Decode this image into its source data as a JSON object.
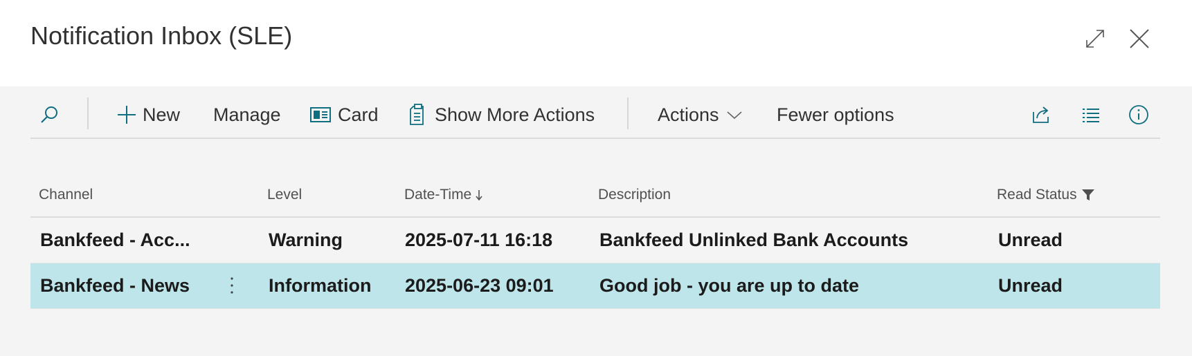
{
  "window": {
    "title": "Notification Inbox (SLE)",
    "expand_icon": "expand-icon",
    "close_icon": "close-icon"
  },
  "toolbar": {
    "search_icon": "search-icon",
    "new_label": "New",
    "manage_label": "Manage",
    "card_label": "Card",
    "show_more_actions_label": "Show More Actions",
    "actions_label": "Actions",
    "fewer_options_label": "Fewer options",
    "share_icon": "share-icon",
    "list_icon": "list-view-icon",
    "info_icon": "info-icon"
  },
  "table": {
    "columns": {
      "channel": "Channel",
      "level": "Level",
      "datetime": "Date-Time",
      "description": "Description",
      "read_status": "Read Status"
    },
    "sort_column": "datetime",
    "sort_direction": "descending",
    "filtered_column": "read_status",
    "rows": [
      {
        "channel": "Bankfeed - Acc...",
        "level": "Warning",
        "datetime": "2025-07-11 16:18",
        "description": "Bankfeed Unlinked Bank Accounts",
        "read_status": "Unread",
        "selected": false
      },
      {
        "channel": "Bankfeed - News",
        "level": "Information",
        "datetime": "2025-06-23 09:01",
        "description": "Good job - you are up to date",
        "read_status": "Unread",
        "selected": true
      }
    ]
  },
  "colors": {
    "accent": "#0f6e80",
    "selected_row": "#bde5ea",
    "background": "#f4f4f4",
    "header_background": "#ffffff"
  }
}
